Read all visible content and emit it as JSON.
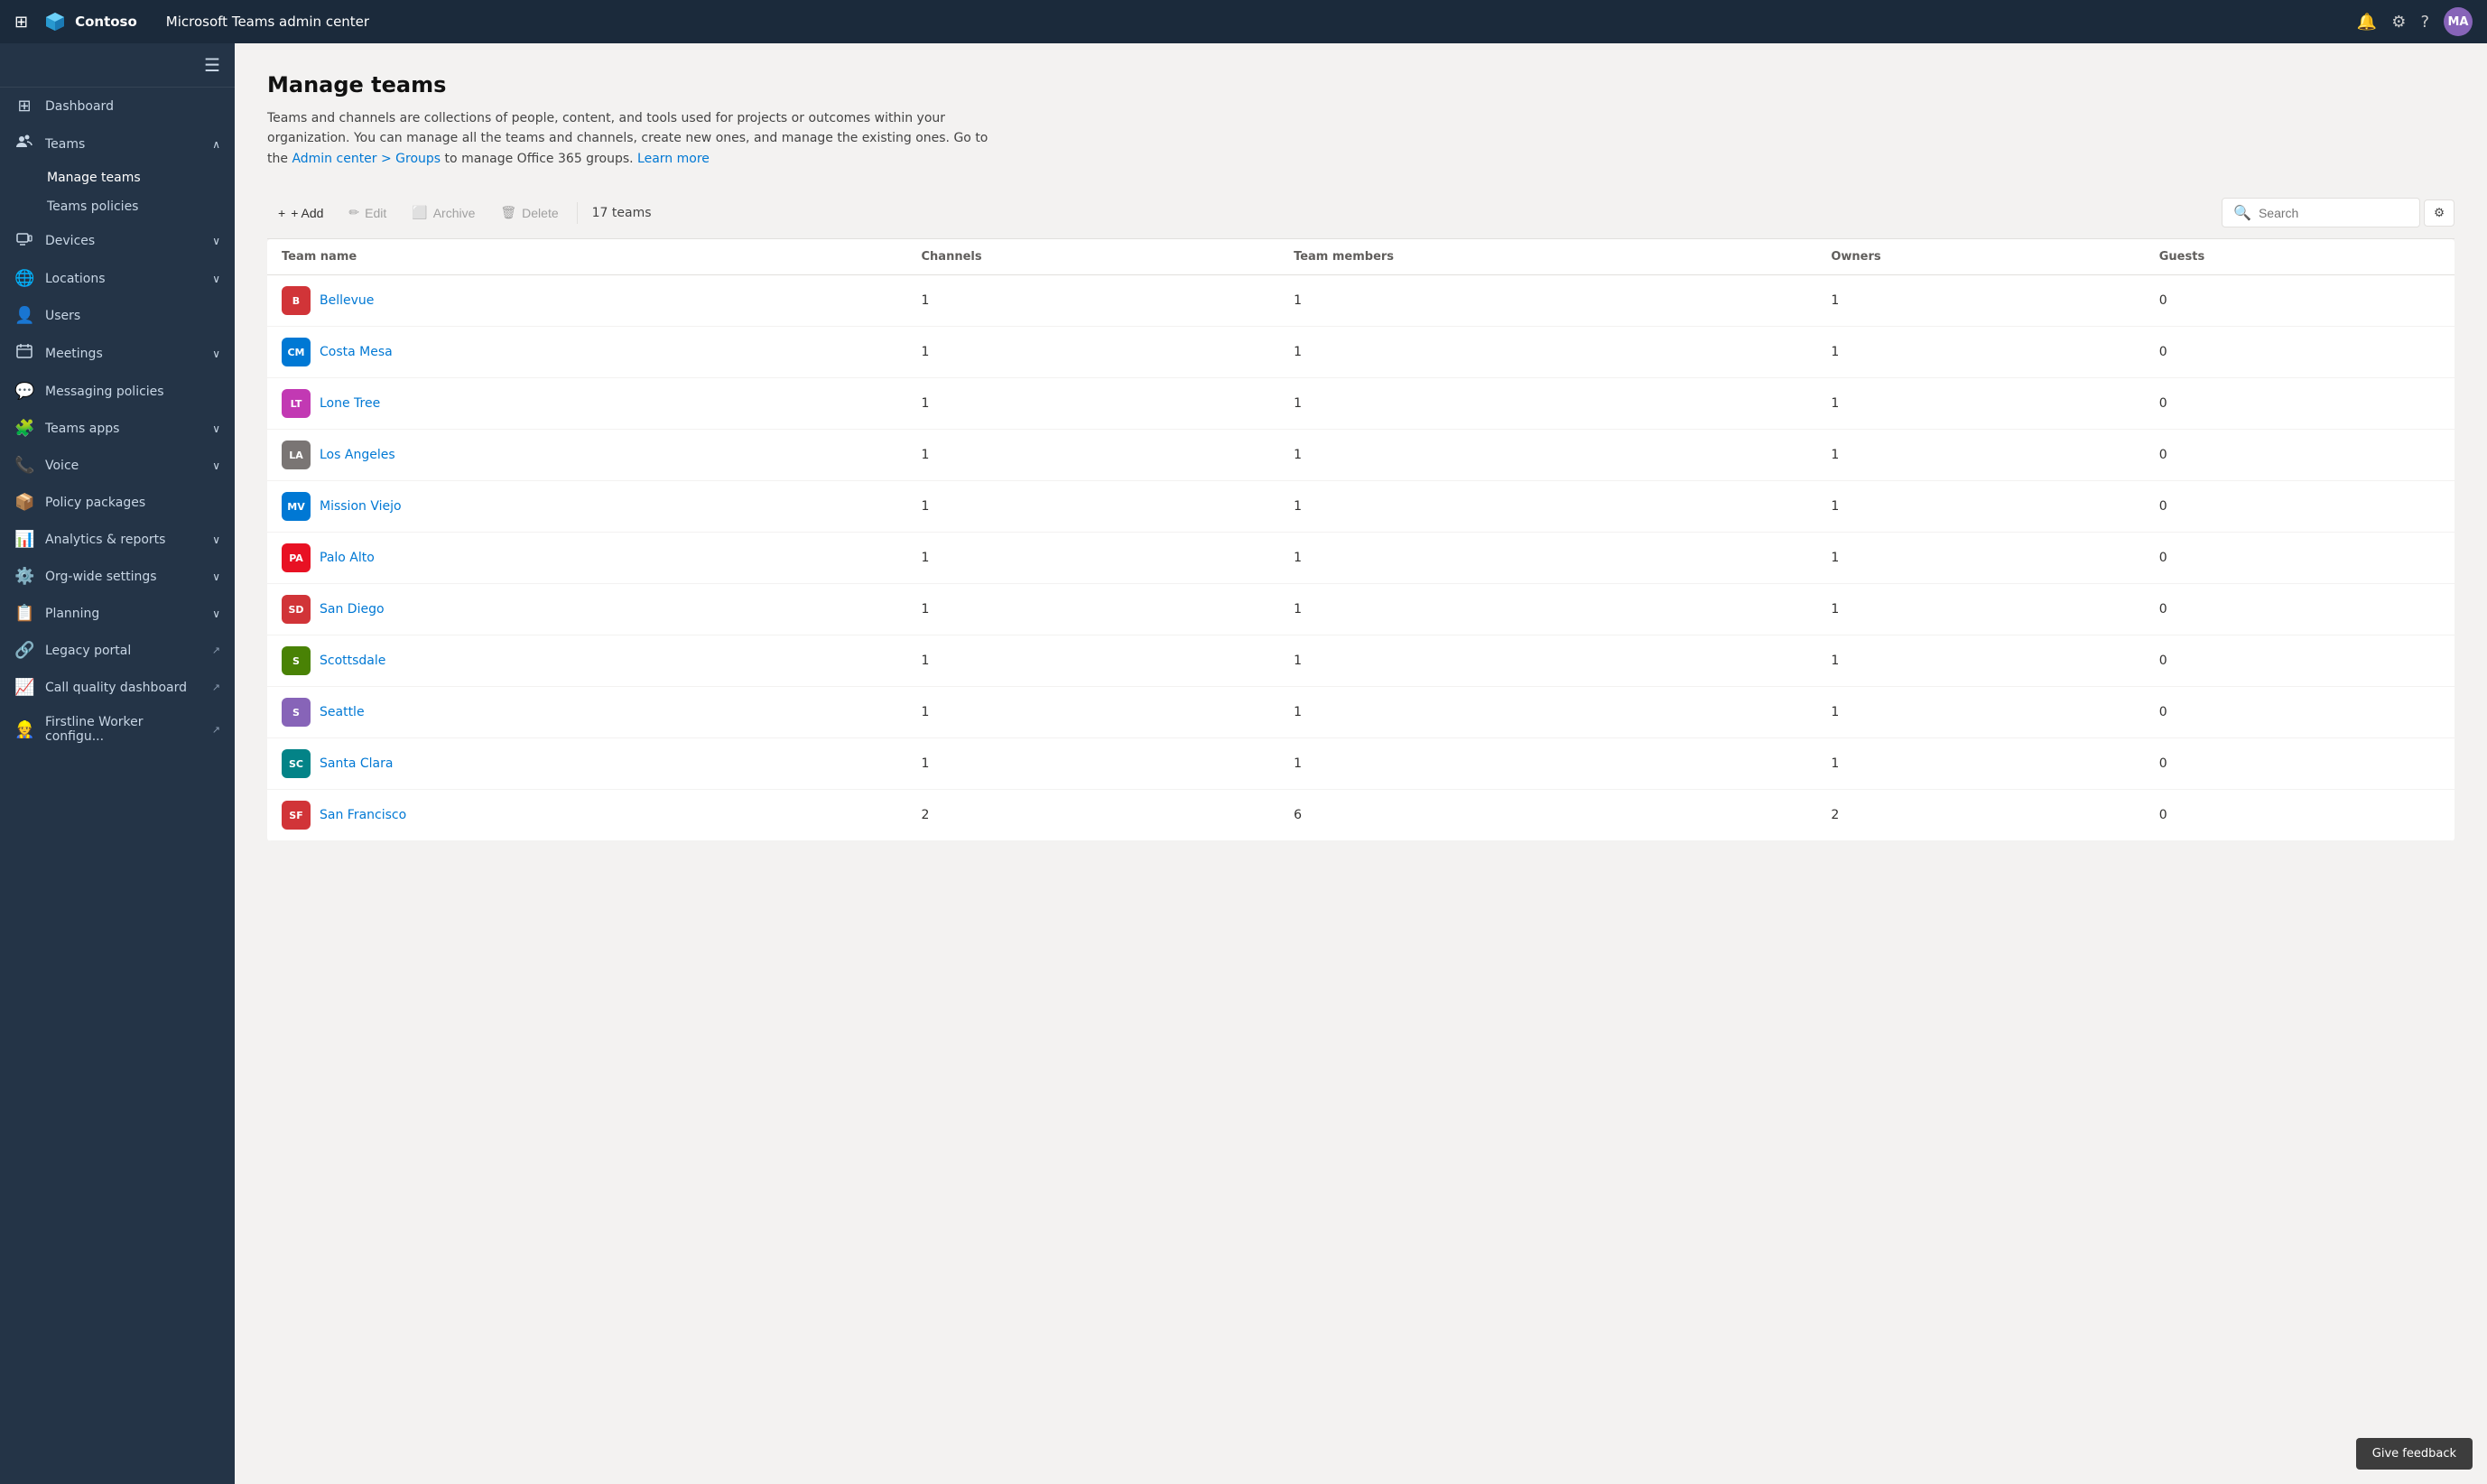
{
  "topbar": {
    "app_name": "Contoso",
    "title": "Microsoft Teams admin center",
    "avatar_initials": "MA",
    "avatar_bg": "#8764b8"
  },
  "sidebar": {
    "hamburger_label": "☰",
    "items": [
      {
        "id": "dashboard",
        "label": "Dashboard",
        "icon": "⊞",
        "expandable": false
      },
      {
        "id": "teams",
        "label": "Teams",
        "icon": "👥",
        "expandable": true,
        "expanded": true,
        "subitems": [
          {
            "id": "manage-teams",
            "label": "Manage teams",
            "active": true
          },
          {
            "id": "teams-policies",
            "label": "Teams policies"
          }
        ]
      },
      {
        "id": "devices",
        "label": "Devices",
        "icon": "📱",
        "expandable": true
      },
      {
        "id": "locations",
        "label": "Locations",
        "icon": "🌐",
        "expandable": true
      },
      {
        "id": "users",
        "label": "Users",
        "icon": "👤",
        "expandable": false
      },
      {
        "id": "meetings",
        "label": "Meetings",
        "icon": "📅",
        "expandable": true
      },
      {
        "id": "messaging-policies",
        "label": "Messaging policies",
        "icon": "💬",
        "expandable": false
      },
      {
        "id": "teams-apps",
        "label": "Teams apps",
        "icon": "🧩",
        "expandable": true
      },
      {
        "id": "voice",
        "label": "Voice",
        "icon": "📞",
        "expandable": true
      },
      {
        "id": "policy-packages",
        "label": "Policy packages",
        "icon": "📦",
        "expandable": false
      },
      {
        "id": "analytics-reports",
        "label": "Analytics & reports",
        "icon": "📊",
        "expandable": true
      },
      {
        "id": "org-wide-settings",
        "label": "Org-wide settings",
        "icon": "⚙️",
        "expandable": true
      },
      {
        "id": "planning",
        "label": "Planning",
        "icon": "📋",
        "expandable": true
      },
      {
        "id": "legacy-portal",
        "label": "Legacy portal",
        "icon": "🔗",
        "external": true
      },
      {
        "id": "call-quality",
        "label": "Call quality dashboard",
        "icon": "📈",
        "external": true
      },
      {
        "id": "firstline-worker",
        "label": "Firstline Worker configu...",
        "icon": "👷",
        "external": true
      }
    ]
  },
  "page": {
    "title": "Manage teams",
    "description": "Teams and channels are collections of people, content, and tools used for projects or outcomes within your organization. You can manage all the teams and channels, create new ones, and manage the existing ones. Go to the",
    "link1_text": "Admin center > Groups",
    "link1_suffix": " to manage Office 365 groups.",
    "link2_text": "Learn more"
  },
  "toolbar": {
    "add_label": "+ Add",
    "edit_label": "✏ Edit",
    "archive_label": "Archive",
    "delete_label": "Delete",
    "team_count": "17 teams",
    "search_placeholder": "Search",
    "settings_icon": "⚙"
  },
  "table": {
    "columns": [
      "Team name",
      "Channels",
      "Team members",
      "Owners",
      "Guests"
    ],
    "rows": [
      {
        "id": 1,
        "name": "Bellevue",
        "initials": "B",
        "color": "#d13438",
        "channels": 1,
        "members": 1,
        "owners": 1,
        "guests": 0
      },
      {
        "id": 2,
        "name": "Costa Mesa",
        "initials": "CM",
        "color": "#0078d4",
        "channels": 1,
        "members": 1,
        "owners": 1,
        "guests": 0
      },
      {
        "id": 3,
        "name": "Lone Tree",
        "initials": "LT",
        "color": "#c239b3",
        "channels": 1,
        "members": 1,
        "owners": 1,
        "guests": 0
      },
      {
        "id": 4,
        "name": "Los Angeles",
        "initials": "LA",
        "color": "#7a7574",
        "channels": 1,
        "members": 1,
        "owners": 1,
        "guests": 0
      },
      {
        "id": 5,
        "name": "Mission Viejo",
        "initials": "MV",
        "color": "#0078d4",
        "channels": 1,
        "members": 1,
        "owners": 1,
        "guests": 0
      },
      {
        "id": 6,
        "name": "Palo Alto",
        "initials": "PA",
        "color": "#e81123",
        "channels": 1,
        "members": 1,
        "owners": 1,
        "guests": 0
      },
      {
        "id": 7,
        "name": "San Diego",
        "initials": "SD",
        "color": "#d13438",
        "channels": 1,
        "members": 1,
        "owners": 1,
        "guests": 0
      },
      {
        "id": 8,
        "name": "Scottsdale",
        "initials": "S",
        "color": "#498205",
        "channels": 1,
        "members": 1,
        "owners": 1,
        "guests": 0
      },
      {
        "id": 9,
        "name": "Seattle",
        "initials": "S",
        "color": "#8764b8",
        "channels": 1,
        "members": 1,
        "owners": 1,
        "guests": 0
      },
      {
        "id": 10,
        "name": "Santa Clara",
        "initials": "SC",
        "color": "#038387",
        "channels": 1,
        "members": 1,
        "owners": 1,
        "guests": 0
      },
      {
        "id": 11,
        "name": "San Francisco",
        "initials": "SF",
        "color": "#d13438",
        "channels": 2,
        "members": 6,
        "owners": 2,
        "guests": 0
      }
    ]
  },
  "feedback": {
    "label": "Give feedback"
  }
}
